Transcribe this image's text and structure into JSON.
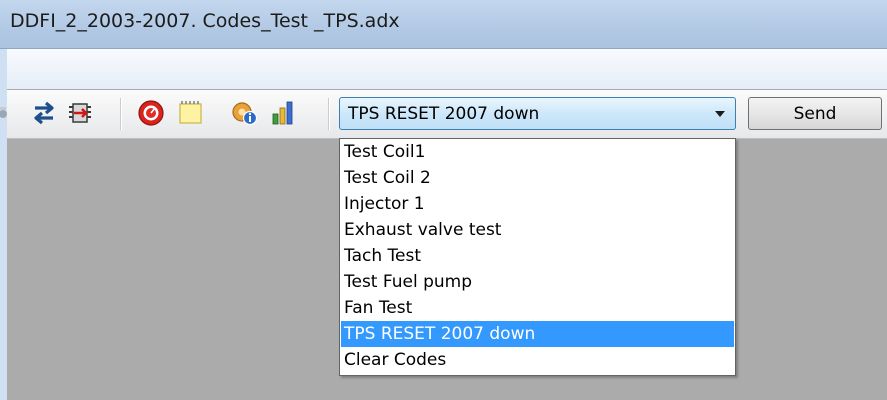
{
  "window": {
    "title": "DDFI_2_2003-2007. Codes_Test _TPS.adx"
  },
  "toolbar": {
    "icons": [
      "partial-icon",
      "swap-arrows-icon",
      "chip-icon",
      "red-gauge-icon",
      "notepad-icon",
      "info-gear-icon",
      "bar-chart-icon"
    ],
    "test_select": {
      "selected": "TPS RESET 2007 down"
    },
    "send_label": "Send"
  },
  "dropdown": {
    "options": [
      "Test Coil1",
      "Test Coil 2",
      "Injector 1",
      "Exhaust valve test",
      "Tach Test",
      "Test Fuel pump",
      "Fan Test",
      "TPS RESET 2007 down",
      "Clear Codes"
    ],
    "highlighted_option": "TPS RESET 2007 down"
  },
  "colors": {
    "highlight": "#3399ff",
    "client_background": "#ababab",
    "combo_border": "#3c7fb1"
  }
}
